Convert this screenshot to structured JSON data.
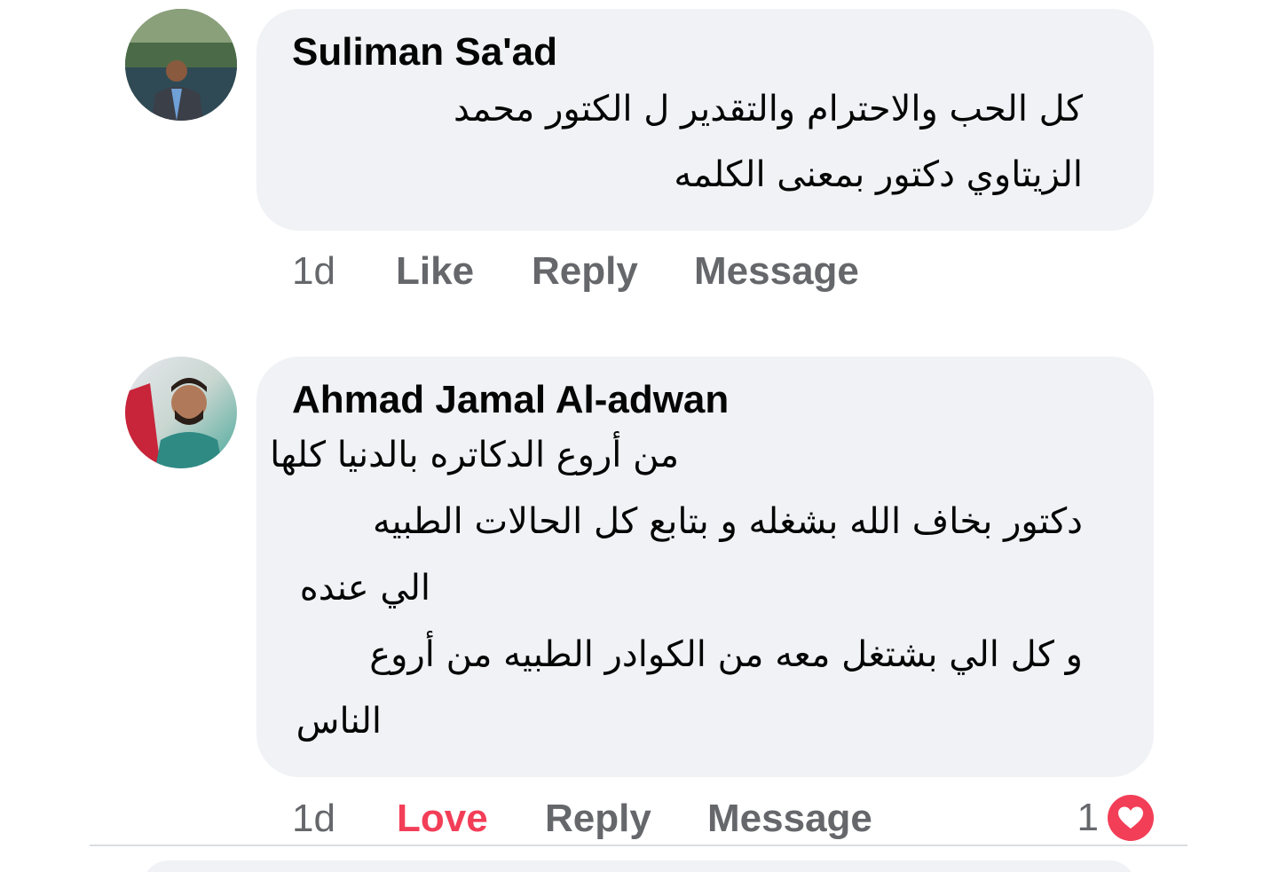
{
  "comments": [
    {
      "author": "Suliman Sa'ad",
      "text_lines": [
        "كل الحب والاحترام والتقدير ل الكتور محمد",
        "الزيتاوي دكتور بمعنى الكلمه"
      ],
      "time": "1d",
      "actions": {
        "like": "Like",
        "reply": "Reply",
        "message": "Message"
      }
    },
    {
      "author": "Ahmad Jamal Al-adwan",
      "text_lines": [
        "من أروع الدكاتره بالدنيا كلها",
        "دكتور بخاف الله بشغله و بتابع كل الحالات الطبيه",
        "الي عنده",
        "و كل الي  بشتغل معه من الكوادر الطبيه من أروع",
        "الناس"
      ],
      "time": "1d",
      "actions": {
        "like": "Love",
        "reply": "Reply",
        "message": "Message"
      },
      "reaction": {
        "count": "1",
        "icon": "heart-icon",
        "color": "#f33e58"
      }
    }
  ],
  "colors": {
    "bubble": "#f0f2f5",
    "meta_text": "#65676b",
    "love": "#f33e58",
    "text": "#050505"
  }
}
